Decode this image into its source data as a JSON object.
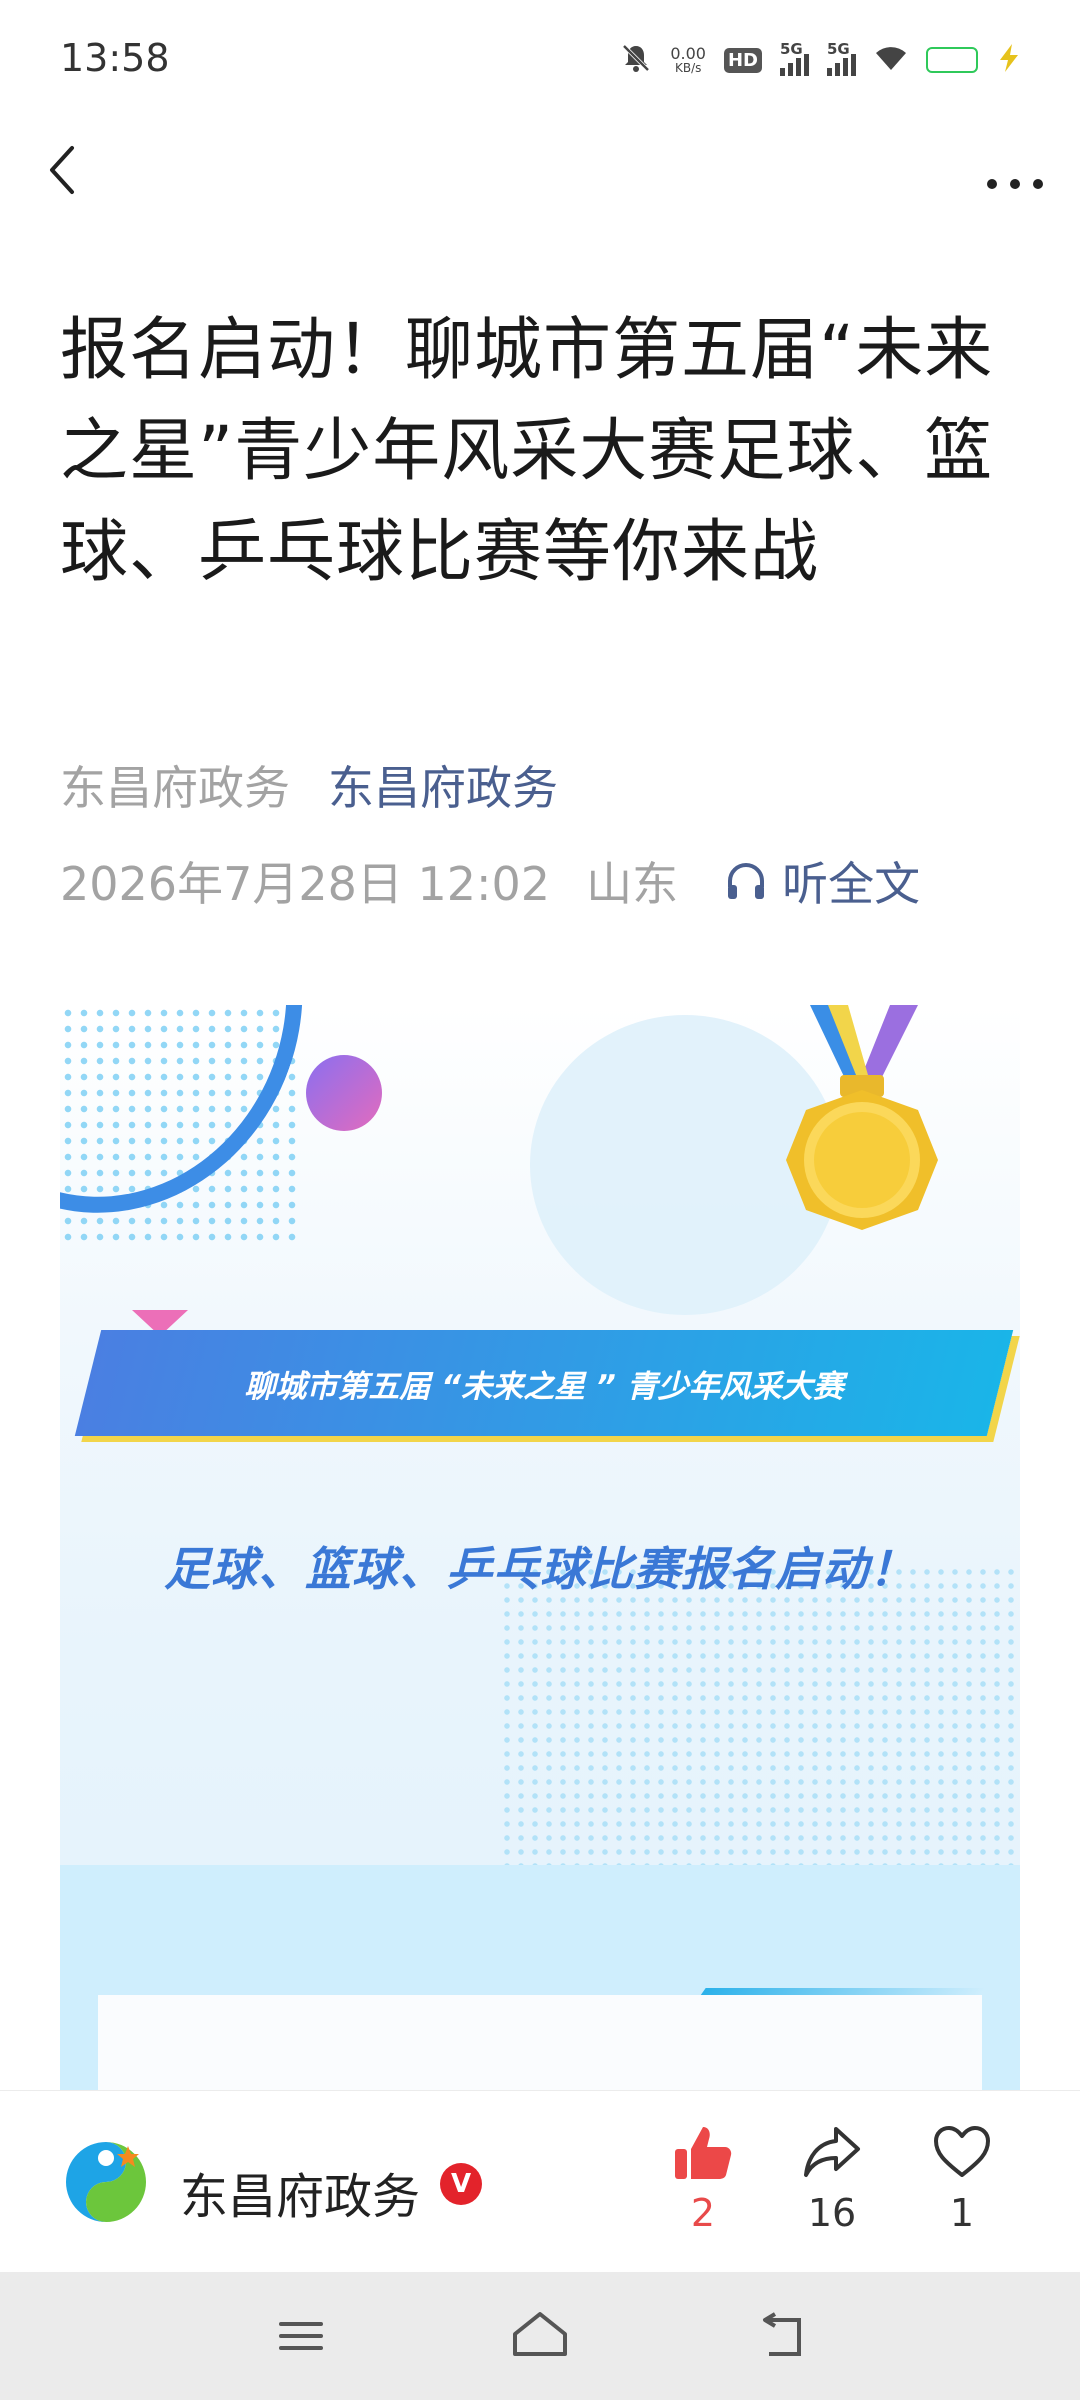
{
  "status_bar": {
    "time": "13:58",
    "net_speed_value": "0.00",
    "net_speed_unit": "KB/s",
    "hd_label": "HD",
    "signal_1_label": "5G",
    "signal_2_label": "5G",
    "battery_level": 1.0
  },
  "nav": {
    "back_icon": "chevron-left-icon",
    "more_icon": "more-horizontal-icon"
  },
  "article": {
    "title": "报名启动！聊城市第五届“未来之星”青少年风采大赛足球、篮球、乒乓球比赛等你来战",
    "source_account": "东昌府政务",
    "source_publisher": "东昌府政务",
    "datetime": "2026年7月28日 12:02",
    "location": "山东",
    "listen_label": "听全文"
  },
  "banner": {
    "ribbon_text": "聊城市第五届 “未来之星 ” 青少年风采大赛",
    "slogan": "足球、篮球、乒乓球比赛报名启动！",
    "colors": {
      "ribbon_start": "#4a7fe2",
      "ribbon_end": "#1ab5e8",
      "slogan": "#3a78d6",
      "medal": "#f2c73a"
    }
  },
  "action_bar": {
    "author_name": "东昌府政务",
    "verified_badge": "V",
    "like_count": "2",
    "share_count": "16",
    "favorite_count": "1",
    "colors": {
      "like": "#e84a4a"
    }
  }
}
